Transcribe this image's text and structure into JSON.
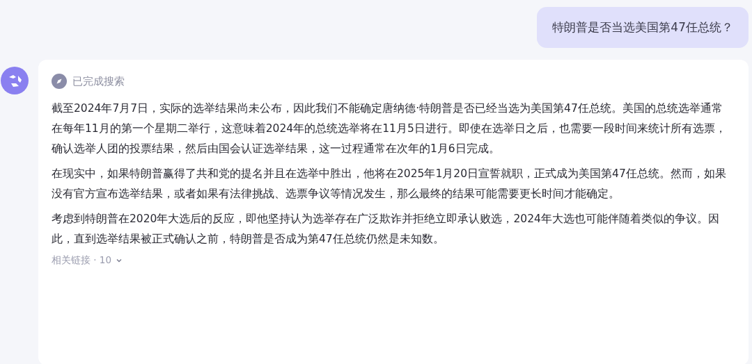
{
  "user_message": {
    "text": "特朗普是否当选美国第47任总统？"
  },
  "assistant_message": {
    "search_status": "已完成搜索",
    "paragraphs": [
      "截至2024年7月7日，实际的选举结果尚未公布，因此我们不能确定唐纳德·特朗普是否已经当选为美国第47任总统。美国的总统选举通常在每年11月的第一个星期二举行，这意味着2024年的总统选举将在11月5日进行。即使在选举日之后，也需要一段时间来统计所有选票，确认选举人团的投票结果，然后由国会认证选举结果，这一过程通常在次年的1月6日完成。",
      "在现实中，如果特朗普赢得了共和党的提名并且在选举中胜出，他将在2025年1月20日宣誓就职，正式成为美国第47任总统。然而，如果没有官方宣布选举结果，或者如果有法律挑战、选票争议等情况发生，那么最终的结果可能需要更长时间才能确定。",
      "考虑到特朗普在2020年大选后的反应，即他坚持认为选举存在广泛欺诈并拒绝立即承认败选，2024年大选也可能伴随着类似的争议。因此，直到选举结果被正式确认之前，特朗普是否成为第47任总统仍然是未知数。"
    ],
    "related_links": {
      "label": "相关链接 · 10",
      "expanded": false
    }
  }
}
